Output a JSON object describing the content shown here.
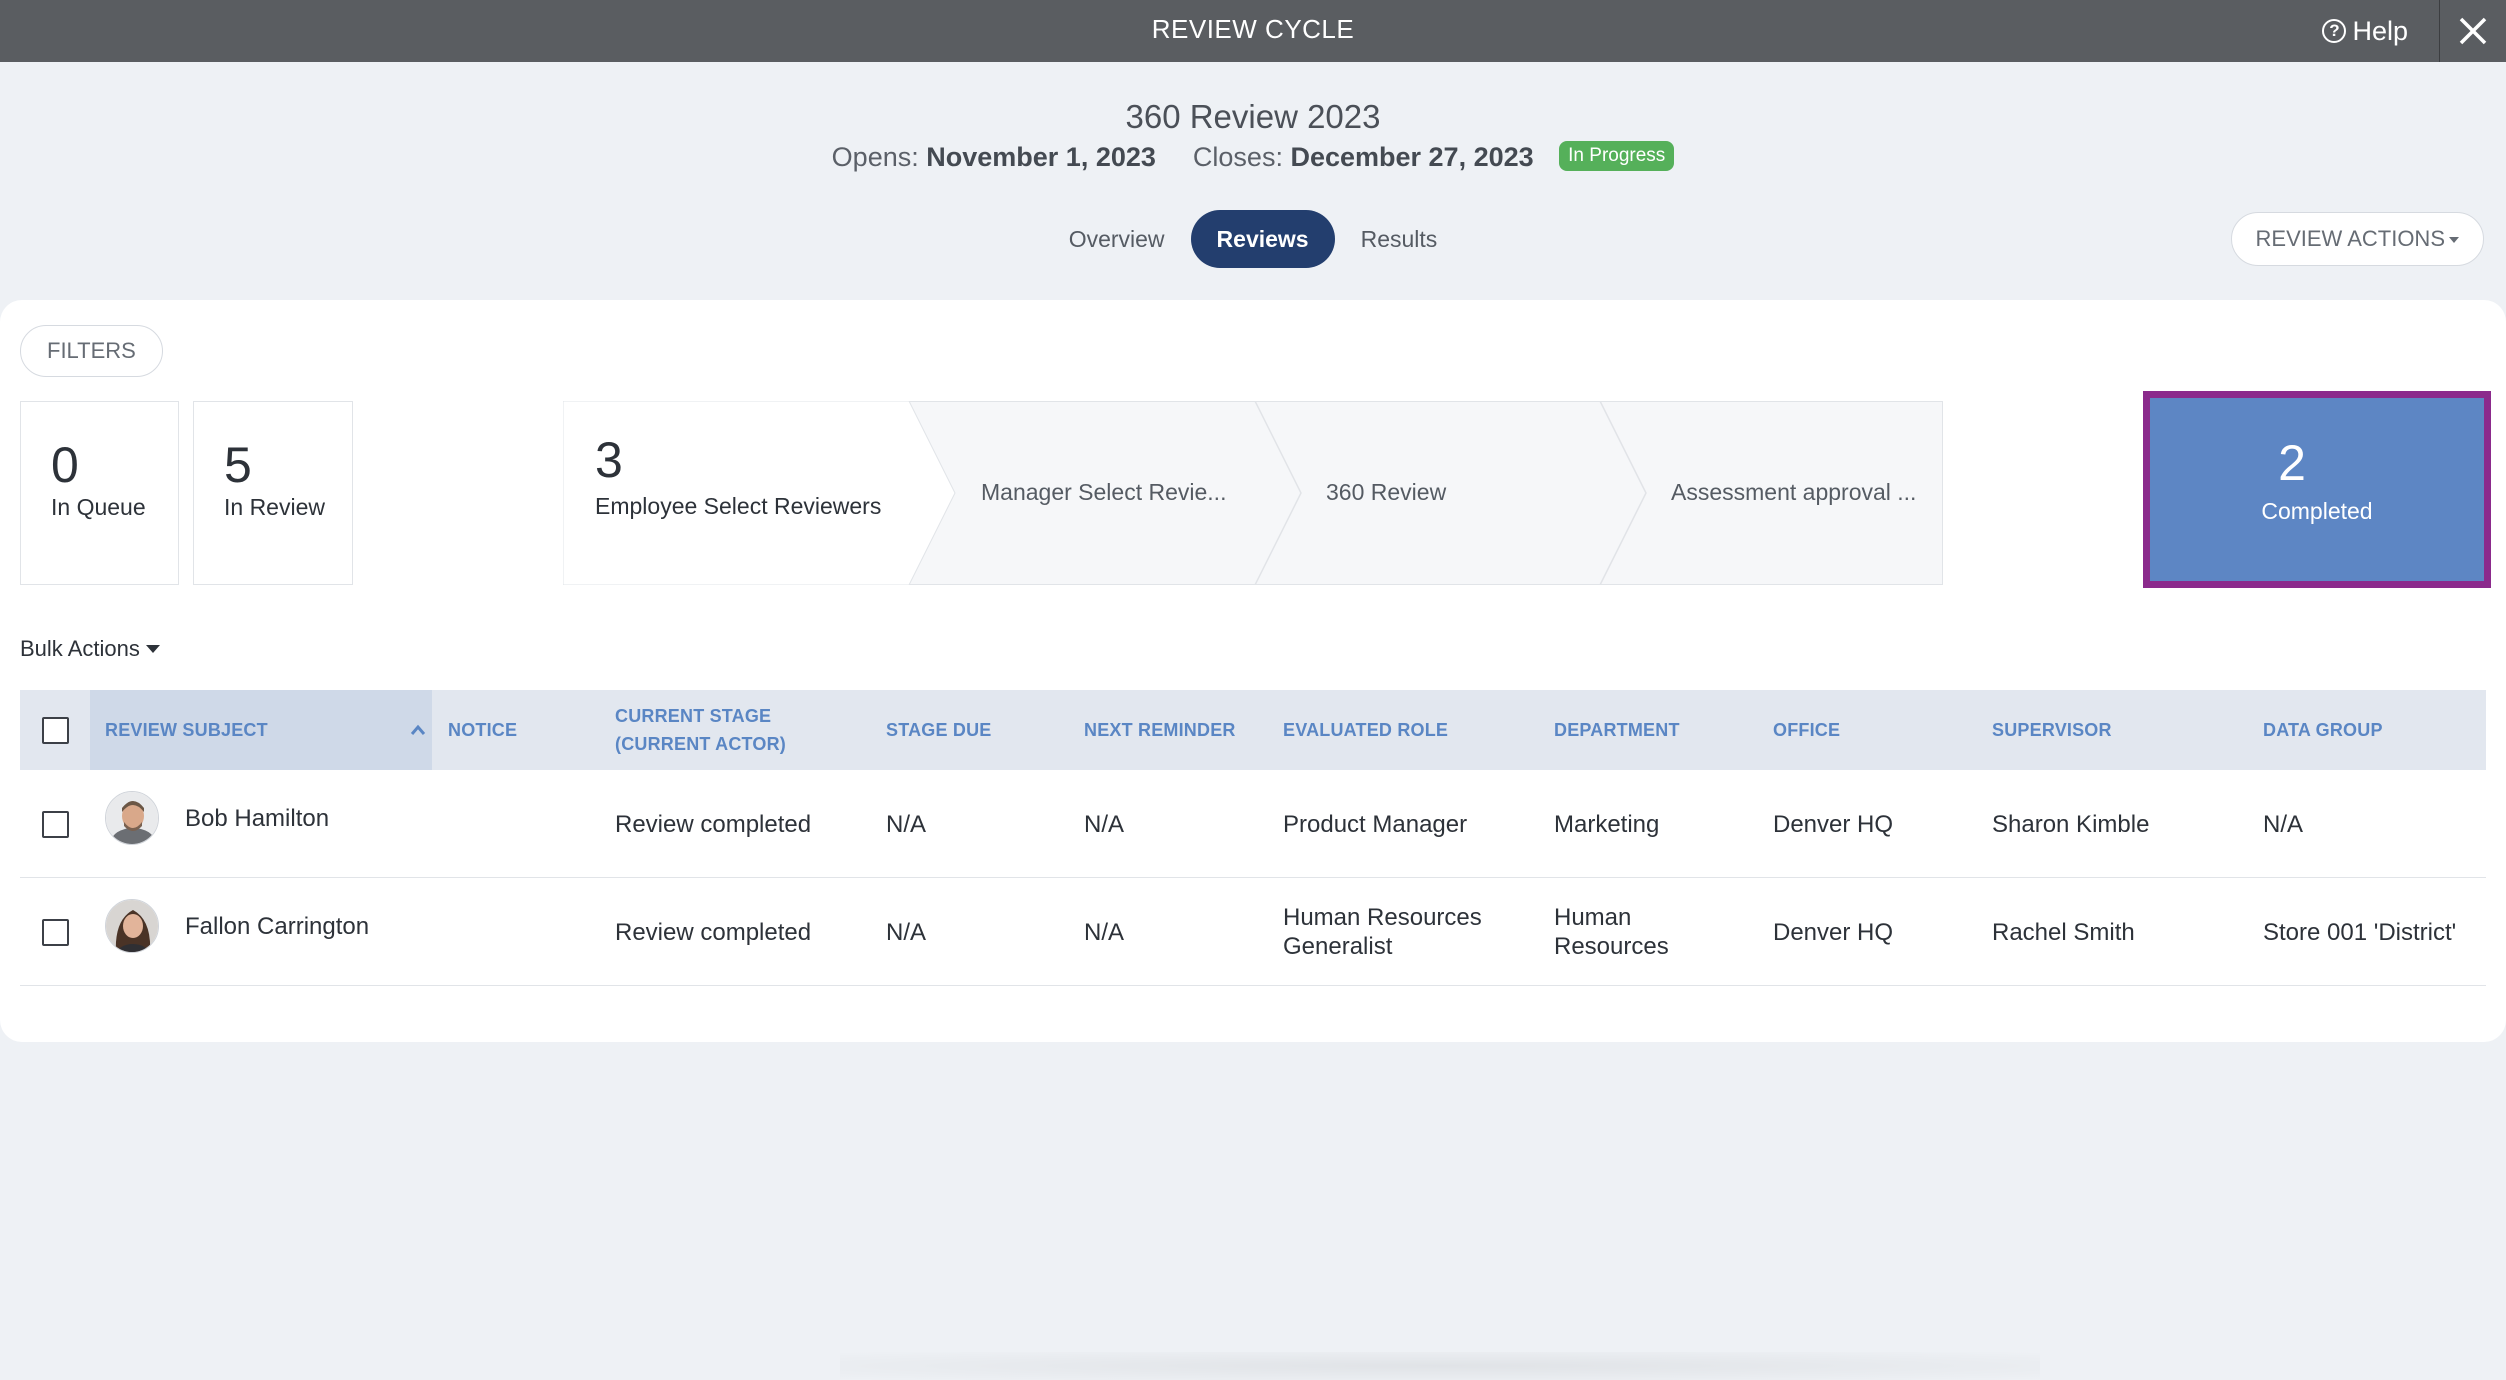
{
  "topbar": {
    "title": "REVIEW CYCLE",
    "help_label": "Help",
    "help_icon": "question-circle-icon",
    "close_icon": "close-icon"
  },
  "header": {
    "title": "360 Review 2023",
    "opens_label": "Opens:",
    "opens_date": "November 1, 2023",
    "closes_label": "Closes:",
    "closes_date": "December 27, 2023",
    "status_badge": "In Progress",
    "status_color": "#55b05a"
  },
  "tabs": [
    {
      "label": "Overview",
      "active": false
    },
    {
      "label": "Reviews",
      "active": true
    },
    {
      "label": "Results",
      "active": false
    }
  ],
  "review_actions_label": "REVIEW ACTIONS",
  "filters_label": "FILTERS",
  "stats": {
    "in_queue": {
      "count": "0",
      "label": "In Queue"
    },
    "in_review": {
      "count": "5",
      "label": "In Review"
    }
  },
  "pipeline": [
    {
      "count": "3",
      "label": "Employee Select Reviewers"
    },
    {
      "count": "",
      "label": "Manager Select Revie..."
    },
    {
      "count": "",
      "label": "360 Review"
    },
    {
      "count": "",
      "label": "Assessment approval ..."
    }
  ],
  "completed": {
    "count": "2",
    "label": "Completed",
    "color": "#5d86c4",
    "highlight_color": "#8b2a8c"
  },
  "bulk_actions_label": "Bulk Actions",
  "table": {
    "columns": [
      "REVIEW SUBJECT",
      "NOTICE",
      "CURRENT STAGE\n(CURRENT ACTOR)",
      "STAGE DUE",
      "NEXT REMINDER",
      "EVALUATED ROLE",
      "DEPARTMENT",
      "OFFICE",
      "SUPERVISOR",
      "DATA GROUP"
    ],
    "sorted_column": "REVIEW SUBJECT",
    "rows": [
      {
        "subject": "Bob Hamilton",
        "notice": "",
        "stage": "Review completed",
        "stage_due": "N/A",
        "next_reminder": "N/A",
        "role": "Product Manager",
        "department": "Marketing",
        "office": "Denver HQ",
        "supervisor": "Sharon Kimble",
        "data_group": "N/A"
      },
      {
        "subject": "Fallon Carrington",
        "notice": "",
        "stage": "Review completed",
        "stage_due": "N/A",
        "next_reminder": "N/A",
        "role": "Human Resources Generalist",
        "department": "Human Resources",
        "office": "Denver HQ",
        "supervisor": "Rachel Smith",
        "data_group": "Store 001 'District'"
      }
    ]
  }
}
